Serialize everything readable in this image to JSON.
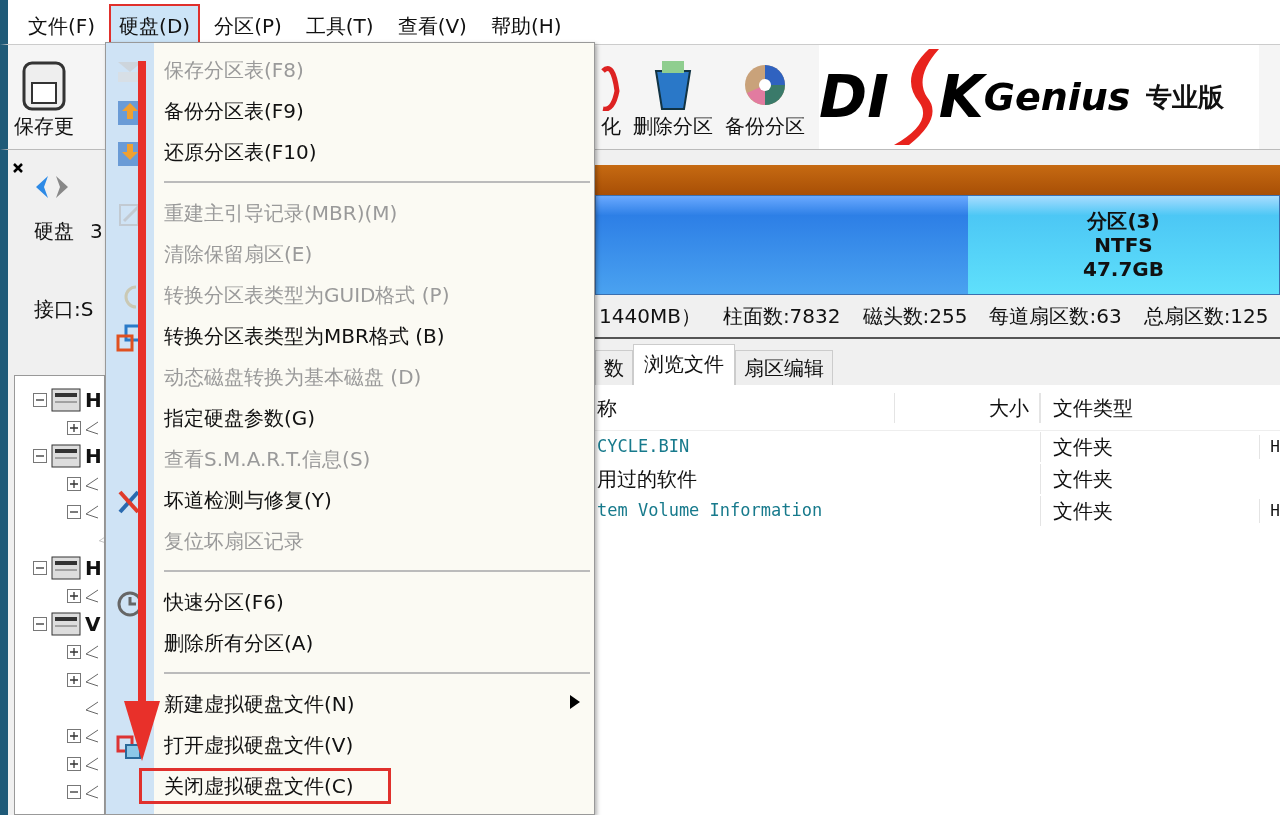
{
  "menu_bar": [
    {
      "label": "文件(F)",
      "selected": false,
      "annotated": false
    },
    {
      "label": "硬盘(D)",
      "selected": true,
      "annotated": true
    },
    {
      "label": "分区(P)",
      "selected": false,
      "annotated": false
    },
    {
      "label": "工具(T)",
      "selected": false,
      "annotated": false
    },
    {
      "label": "查看(V)",
      "selected": false,
      "annotated": false
    },
    {
      "label": "帮助(H)",
      "selected": false,
      "annotated": false
    }
  ],
  "toolbar": {
    "left": [
      {
        "label": "保存更"
      }
    ],
    "right": [
      {
        "label": "化"
      },
      {
        "label": "删除分区"
      },
      {
        "label": "备份分区"
      }
    ],
    "logo": {
      "parts": [
        "DI",
        "K",
        "Genius"
      ],
      "edition": "专业版"
    }
  },
  "disk_panel": {
    "label": "硬盘",
    "value": "3",
    "interface": "接口:S"
  },
  "tree": [
    {
      "label": "H",
      "expanded": true,
      "children": [
        {
          "expanded": false
        }
      ]
    },
    {
      "label": "H",
      "expanded": true,
      "children": [
        {
          "expanded": false
        },
        {
          "expanded": true,
          "children": [
            {
              "leaf": true
            }
          ]
        }
      ]
    },
    {
      "label": "H",
      "expanded": true,
      "children": [
        {
          "expanded": false
        }
      ]
    },
    {
      "label": "V",
      "expanded": true,
      "children": [
        {
          "expanded": false
        },
        {
          "expanded": false
        },
        {
          "leaf": true
        },
        {
          "expanded": false
        },
        {
          "expanded": false
        },
        {
          "expanded": true
        }
      ]
    }
  ],
  "partition_bar": {
    "label": "分区(3)",
    "fs": "NTFS",
    "size": "47.7GB",
    "selected": true
  },
  "disk_info": [
    "1440MB）",
    "柱面数:7832",
    "磁头数:255",
    "每道扇区数:63",
    "总扇区数:125"
  ],
  "tabs": [
    {
      "label": "数",
      "selected": false
    },
    {
      "label": "浏览文件",
      "selected": true
    },
    {
      "label": "扇区编辑",
      "selected": false
    }
  ],
  "table": {
    "columns": [
      "称",
      "大小",
      "文件类型"
    ],
    "rows": [
      {
        "name": "CYCLE.BIN",
        "size": "",
        "type": "文件夹",
        "column_4": "H",
        "system": true
      },
      {
        "name": "用过的软件",
        "size": "",
        "type": "文件夹",
        "column_4": "",
        "system": false
      },
      {
        "name": "tem Volume Information",
        "size": "",
        "type": "文件夹",
        "column_4": "H",
        "system": true
      }
    ]
  },
  "dropdown": [
    {
      "kind": "item",
      "label": "保存分区表(F8)",
      "disabled": true,
      "annotated": false
    },
    {
      "kind": "item",
      "label": "备份分区表(F9)",
      "disabled": false,
      "annotated": false
    },
    {
      "kind": "item",
      "label": "还原分区表(F10)",
      "disabled": false,
      "annotated": false
    },
    {
      "kind": "separator"
    },
    {
      "kind": "item",
      "label": "重建主引导记录(MBR)(M)",
      "disabled": true,
      "annotated": false
    },
    {
      "kind": "item",
      "label": "清除保留扇区(E)",
      "disabled": true,
      "annotated": false
    },
    {
      "kind": "item",
      "label": "转换分区表类型为GUID格式 (P)",
      "disabled": true,
      "annotated": false
    },
    {
      "kind": "item",
      "label": "转换分区表类型为MBR格式 (B)",
      "disabled": false,
      "annotated": false
    },
    {
      "kind": "item",
      "label": "动态磁盘转换为基本磁盘 (D)",
      "disabled": true,
      "annotated": false
    },
    {
      "kind": "item",
      "label": "指定硬盘参数(G)",
      "disabled": false,
      "annotated": false
    },
    {
      "kind": "item",
      "label": "查看S.M.A.R.T.信息(S)",
      "disabled": true,
      "annotated": false
    },
    {
      "kind": "item",
      "label": "坏道检测与修复(Y)",
      "disabled": false,
      "annotated": false
    },
    {
      "kind": "item",
      "label": "复位坏扇区记录",
      "disabled": true,
      "annotated": false
    },
    {
      "kind": "separator"
    },
    {
      "kind": "item",
      "label": "快速分区(F6)",
      "disabled": false,
      "annotated": false
    },
    {
      "kind": "item",
      "label": "删除所有分区(A)",
      "disabled": false,
      "annotated": false
    },
    {
      "kind": "separator"
    },
    {
      "kind": "submenu",
      "label": "新建虚拟硬盘文件(N)",
      "disabled": false,
      "annotated": false
    },
    {
      "kind": "item",
      "label": "打开虚拟硬盘文件(V)",
      "disabled": false,
      "annotated": false
    },
    {
      "kind": "item",
      "label": "关闭虚拟硬盘文件(C)",
      "disabled": false,
      "annotated": true
    }
  ]
}
